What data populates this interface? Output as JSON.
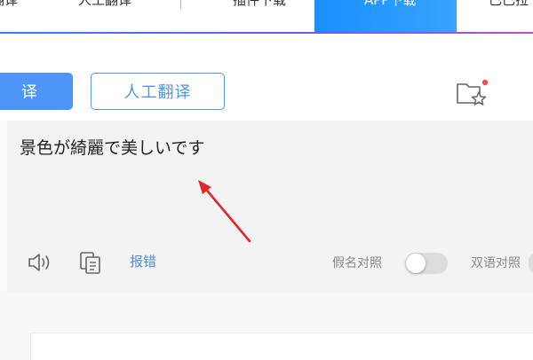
{
  "nav": {
    "items": [
      {
        "label": "翻译"
      },
      {
        "label": "人工翻译"
      },
      {
        "label": "插件下载"
      },
      {
        "label": "APP下载"
      },
      {
        "label": "已已拉"
      }
    ]
  },
  "toolbar": {
    "translate_label": "译",
    "human_translate_label": "人工翻译"
  },
  "editor": {
    "source_text": "景色が綺麗で美しいです"
  },
  "actions": {
    "report_label": "报错",
    "kana_toggle_label": "假名对照",
    "bilingual_toggle_label": "双语对照"
  },
  "colors": {
    "accent": "#4d95f7",
    "arrow": "#e8232a",
    "badge": "#f05050"
  }
}
